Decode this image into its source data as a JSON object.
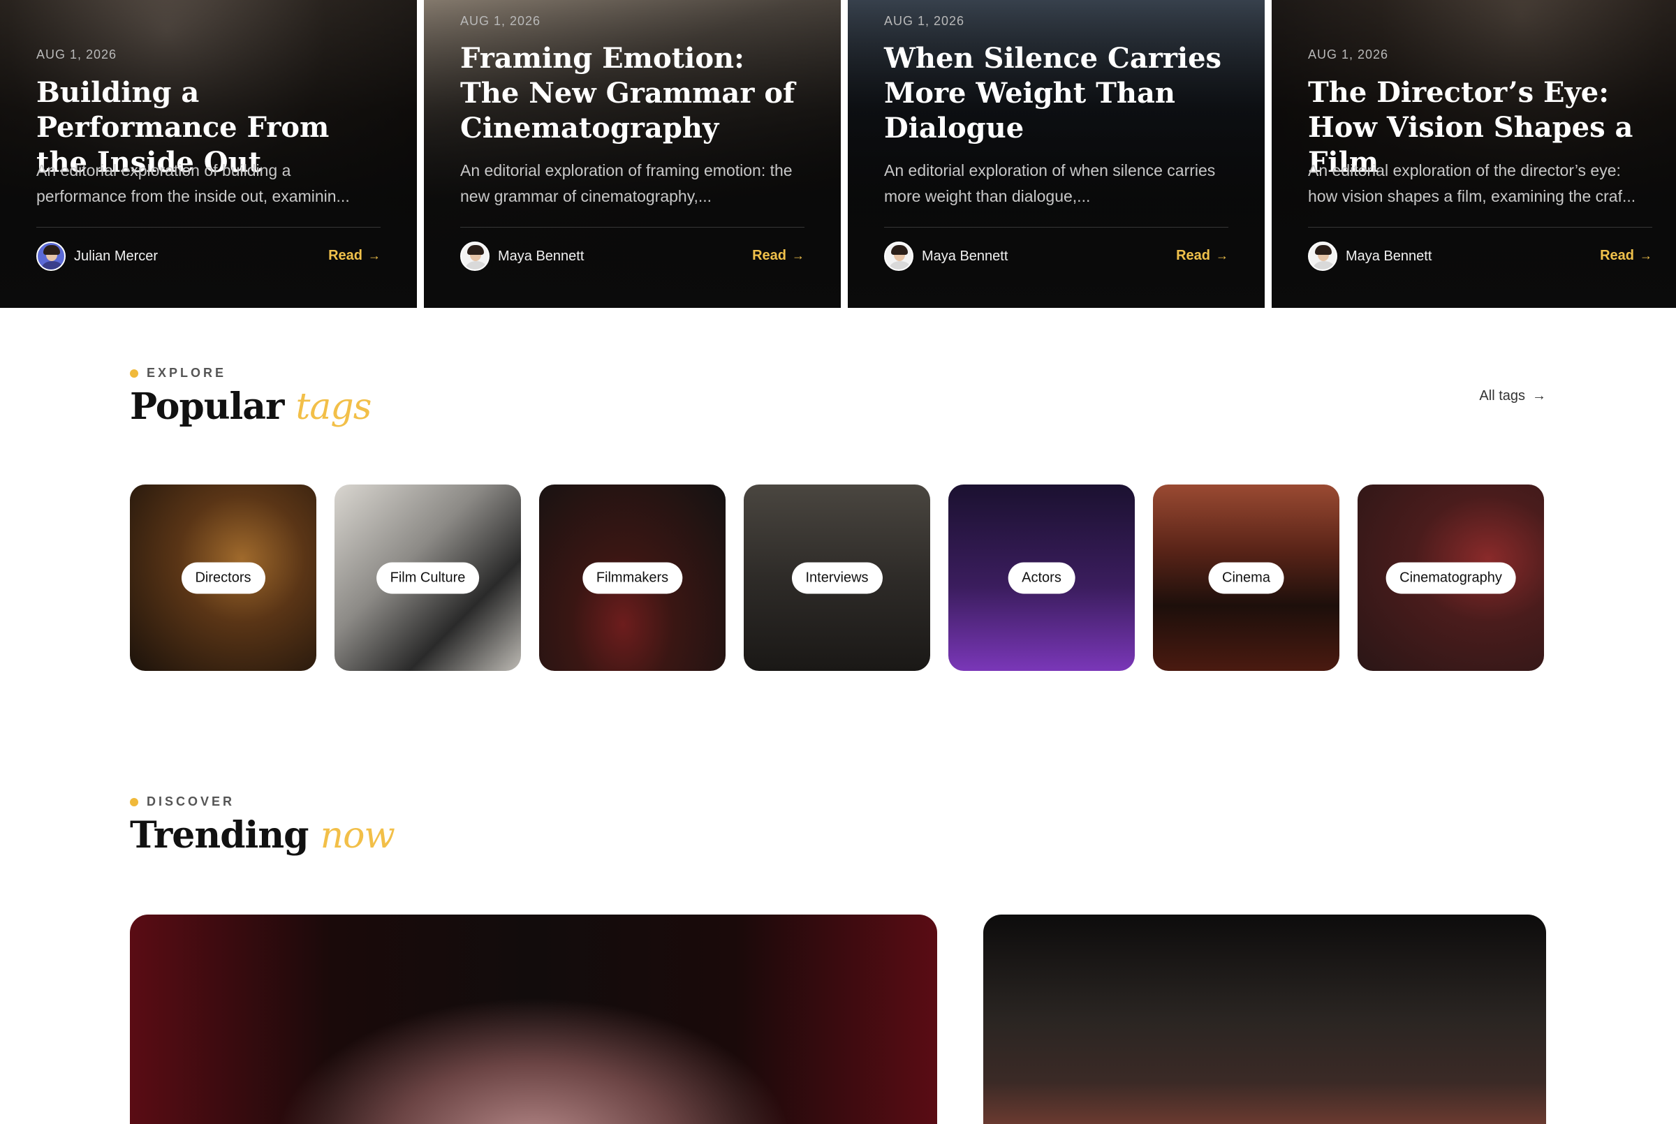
{
  "featured": [
    {
      "date": "AUG 1, 2026",
      "title": "Building a Performance From the Inside Out",
      "excerpt": "An editorial exploration of building a performance from the inside out, examinin...",
      "author": "Julian Mercer",
      "read_label": "Read"
    },
    {
      "date": "AUG 1, 2026",
      "title": "Framing Emotion: The New Grammar of Cinematography",
      "excerpt": "An editorial exploration of framing emotion: the new grammar of cinematography,...",
      "author": "Maya Bennett",
      "read_label": "Read"
    },
    {
      "date": "AUG 1, 2026",
      "title": "When Silence Carries More Weight Than Dialogue",
      "excerpt": "An editorial exploration of when silence carries more weight than dialogue,...",
      "author": "Maya Bennett",
      "read_label": "Read"
    },
    {
      "date": "AUG 1, 2026",
      "title": "The Director’s Eye: How Vision Shapes a Film",
      "excerpt": "An editorial exploration of the director’s eye: how vision shapes a film, examining the craf...",
      "author": "Maya Bennett",
      "read_label": "Read"
    }
  ],
  "explore": {
    "eyebrow": "EXPLORE",
    "title_main": "Popular",
    "title_accent": "tags",
    "all_tags_label": "All tags"
  },
  "tags": [
    {
      "label": "Directors"
    },
    {
      "label": "Film Culture"
    },
    {
      "label": "Filmmakers"
    },
    {
      "label": "Interviews"
    },
    {
      "label": "Actors"
    },
    {
      "label": "Cinema"
    },
    {
      "label": "Cinematography"
    }
  ],
  "discover": {
    "eyebrow": "DISCOVER",
    "title_main": "Trending",
    "title_accent": "now"
  },
  "colors": {
    "accent": "#f0c14b",
    "dark": "#0b0b0b"
  }
}
